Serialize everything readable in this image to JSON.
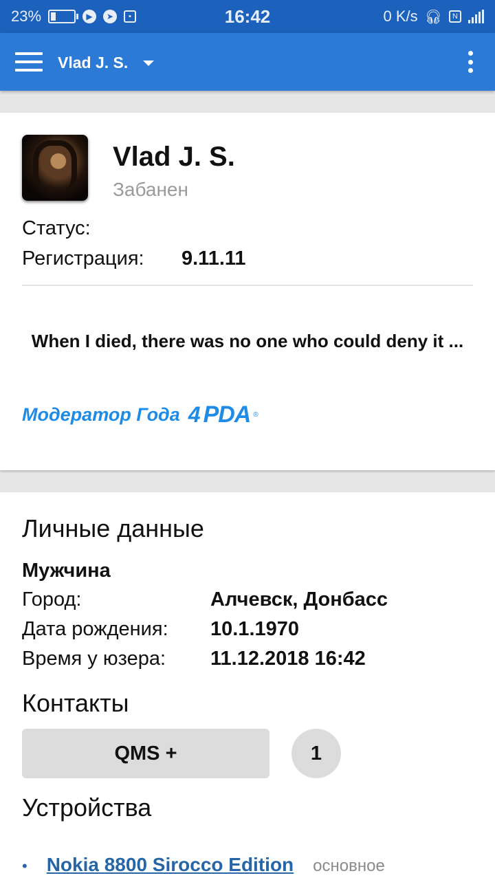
{
  "status_bar": {
    "battery": "23%",
    "battery_level": 0.23,
    "time": "16:42",
    "net_speed": "0 K/s",
    "left_icons": [
      "play-icon",
      "telegram-icon",
      "screenshot-icon"
    ],
    "right_icons": [
      "headset-icon",
      "nfc-icon",
      "signal-icon"
    ]
  },
  "app_bar": {
    "title": "Vlad J. S.",
    "icons": [
      "menu-icon",
      "dropdown-icon",
      "more-icon"
    ],
    "color": "#2a7ad6"
  },
  "profile": {
    "nick": "Vlad J. S.",
    "group": "Забанен",
    "status_label": "Статус:",
    "status_value": "",
    "reg_label": "Регистрация:",
    "reg_value": "9.11.11",
    "signature": "When I died, there was no one who could deny it ...",
    "award_text": "Модератор Года",
    "award_logo_4": "4",
    "award_logo_pda": "PDA",
    "award_logo_reg": "®"
  },
  "personal": {
    "heading": "Личные данные",
    "gender": "Мужчина",
    "city_label": "Город:",
    "city_value": "Алчевск, Донбасс",
    "birth_label": "Дата рождения:",
    "birth_value": "10.1.1970",
    "usertime_label": "Время у юзера:",
    "usertime_value": "11.12.2018 16:42"
  },
  "contacts": {
    "heading": "Контакты",
    "qms_label": "QMS +",
    "qms_count": "1"
  },
  "devices": {
    "heading": "Устройства",
    "items": [
      {
        "bullet": "•",
        "name": "Nokia 8800 Sirocco Edition",
        "kind": "основное"
      }
    ]
  },
  "colors": {
    "status_bar": "#1c62bc",
    "accent": "#1e8be6",
    "link": "#2565a8",
    "muted": "#9a9a9a"
  }
}
